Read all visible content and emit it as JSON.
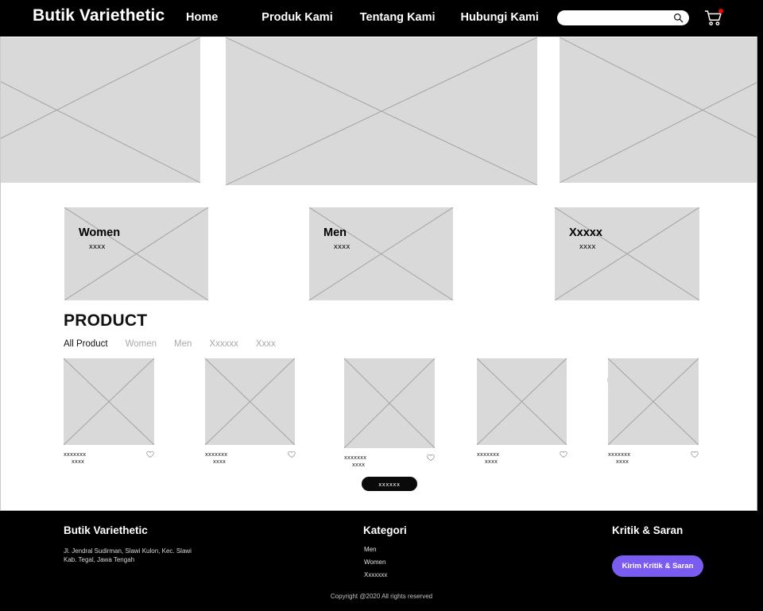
{
  "header": {
    "brand": "Butik Variethetic",
    "nav_items": [
      {
        "label": "Home"
      },
      {
        "label": "Produk Kami"
      },
      {
        "label": "Tentang Kami"
      },
      {
        "label": "Hubungi Kami"
      }
    ],
    "search": {
      "value": "",
      "placeholder": ""
    },
    "search_icon": "search-icon",
    "cart_icon": "shopping-cart-icon",
    "cart_badge_color": "#ff0000"
  },
  "hero": {
    "slides": [
      {
        "alt": "image-placeholder"
      },
      {
        "alt": "image-placeholder"
      },
      {
        "alt": "image-placeholder"
      }
    ]
  },
  "categories": [
    {
      "title": "Women",
      "subtitle": "xxxx"
    },
    {
      "title": "Men",
      "subtitle": "xxxx"
    },
    {
      "title": "Xxxxx",
      "subtitle": "xxxx"
    }
  ],
  "products_section": {
    "heading": "PRODUCT",
    "filters": [
      {
        "label": "All Product",
        "active": true
      },
      {
        "label": "Women",
        "active": false
      },
      {
        "label": "Men",
        "active": false
      },
      {
        "label": "Xxxxxx",
        "active": false
      },
      {
        "label": "Xxxx",
        "active": false
      }
    ],
    "search": {
      "value": "",
      "placeholder": ""
    },
    "search_icon": "search-icon",
    "items": [
      {
        "title": "xxxxxxx",
        "subtitle": "xxxx",
        "wishlist_icon": "heart-icon"
      },
      {
        "title": "xxxxxxx",
        "subtitle": "xxxx",
        "wishlist_icon": "heart-icon"
      },
      {
        "title": "xxxxxxx",
        "subtitle": "xxxx",
        "wishlist_icon": "heart-icon"
      },
      {
        "title": "xxxxxxx",
        "subtitle": "xxxx",
        "wishlist_icon": "heart-icon"
      },
      {
        "title": "xxxxxxx",
        "subtitle": "xxxx",
        "wishlist_icon": "heart-icon"
      }
    ],
    "load_more_label": "xxxxxx"
  },
  "footer": {
    "brand": "Butik Variethetic",
    "address_line1": "Jl. Jendral Sudirman, Slawi Kulon, Kec. Slawi",
    "address_line2": "Kab. Tegal, Jawa Tengah",
    "kategori_title": "Kategori",
    "kategori_items": [
      {
        "label": "Men"
      },
      {
        "label": "Women"
      },
      {
        "label": "Xxxxxxx"
      }
    ],
    "kritik_title": "Kritik & Saran",
    "kritik_button_label": "Kirim Kritik & Saran",
    "kritik_button_color": "#7b5cf0",
    "copyright": "Copyright @2020 All rights reserved"
  }
}
